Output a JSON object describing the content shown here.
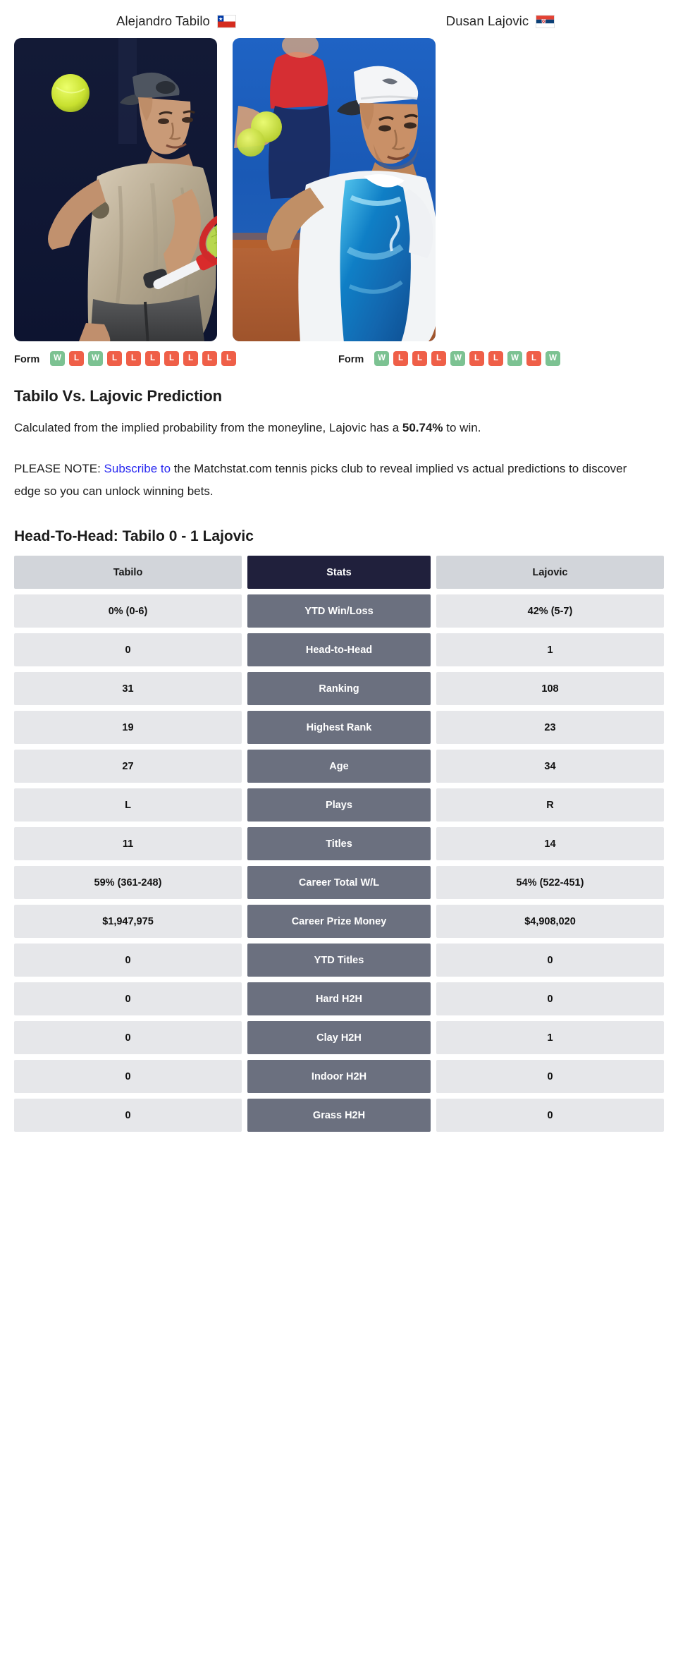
{
  "players": {
    "left": {
      "name": "Alejandro Tabilo",
      "flag": "chile-flag",
      "photo_alt": "tabilo-photo"
    },
    "right": {
      "name": "Dusan Lajovic",
      "flag": "serbia-flag",
      "photo_alt": "lajovic-photo"
    }
  },
  "form": {
    "label": "Form",
    "left": [
      "W",
      "L",
      "W",
      "L",
      "L",
      "L",
      "L",
      "L",
      "L",
      "L"
    ],
    "right": [
      "W",
      "L",
      "L",
      "L",
      "W",
      "L",
      "L",
      "W",
      "L",
      "W"
    ]
  },
  "prediction": {
    "heading": "Tabilo Vs. Lajovic Prediction",
    "line1_before": "Calculated from the implied probability from the moneyline, Lajovic has a ",
    "percent": "50.74%",
    "line1_after": " to win.",
    "note_prefix": "PLEASE NOTE: ",
    "note_link": "Subscribe to",
    "note_suffix": " the Matchstat.com tennis picks club to reveal implied vs actual predictions to discover edge so you can unlock winning bets."
  },
  "h2h": {
    "heading": "Head-To-Head: Tabilo 0 - 1 Lajovic",
    "columns": [
      "Tabilo",
      "Stats",
      "Lajovic"
    ],
    "rows": [
      {
        "stat": "YTD Win/Loss",
        "left": "0% (0-6)",
        "right": "42% (5-7)"
      },
      {
        "stat": "Head-to-Head",
        "left": "0",
        "right": "1"
      },
      {
        "stat": "Ranking",
        "left": "31",
        "right": "108"
      },
      {
        "stat": "Highest Rank",
        "left": "19",
        "right": "23"
      },
      {
        "stat": "Age",
        "left": "27",
        "right": "34"
      },
      {
        "stat": "Plays",
        "left": "L",
        "right": "R"
      },
      {
        "stat": "Titles",
        "left": "11",
        "right": "14"
      },
      {
        "stat": "Career Total W/L",
        "left": "59% (361-248)",
        "right": "54% (522-451)"
      },
      {
        "stat": "Career Prize Money",
        "left": "$1,947,975",
        "right": "$4,908,020"
      },
      {
        "stat": "YTD Titles",
        "left": "0",
        "right": "0"
      },
      {
        "stat": "Hard H2H",
        "left": "0",
        "right": "0"
      },
      {
        "stat": "Clay H2H",
        "left": "0",
        "right": "1"
      },
      {
        "stat": "Indoor H2H",
        "left": "0",
        "right": "0"
      },
      {
        "stat": "Grass H2H",
        "left": "0",
        "right": "0"
      }
    ]
  },
  "colors": {
    "win_badge": "#7cc292",
    "loss_badge": "#ef5f48",
    "header_mid": "#20203c",
    "header_side": "#d2d5da",
    "stat_mid": "#6b707f",
    "stat_side": "#e6e7ea",
    "link": "#2a2af0"
  }
}
